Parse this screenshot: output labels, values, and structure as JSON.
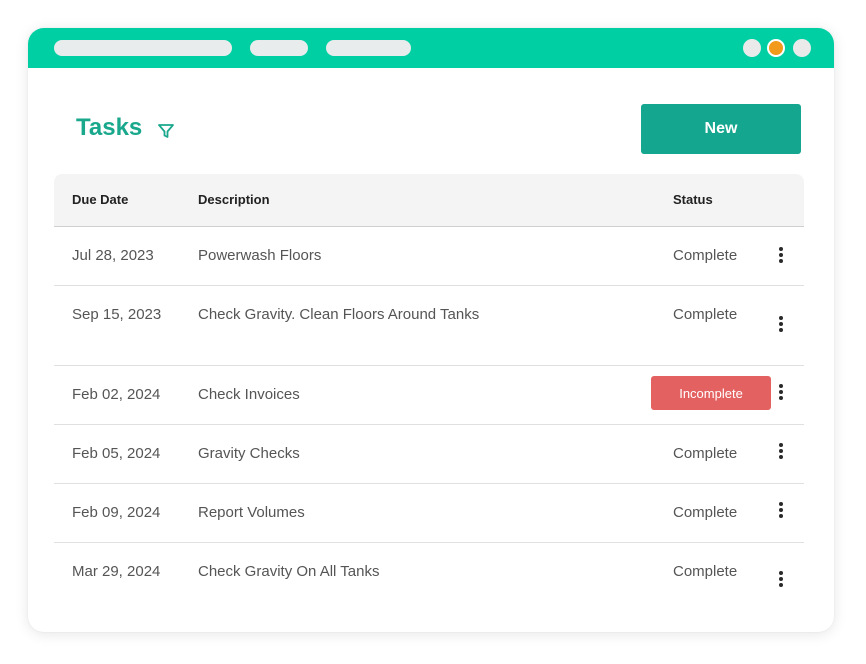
{
  "header": {
    "title": "Tasks",
    "new_label": "New"
  },
  "table": {
    "columns": {
      "due_date": "Due Date",
      "description": "Description",
      "status": "Status"
    },
    "rows": [
      {
        "date": "Jul 28, 2023",
        "description": "Powerwash Floors",
        "status": "Complete"
      },
      {
        "date": "Sep 15, 2023",
        "description": "Check Gravity. Clean Floors Around Tanks",
        "status": "Complete"
      },
      {
        "date": "Feb 02, 2024",
        "description": "Check Invoices",
        "status": "Incomplete"
      },
      {
        "date": "Feb 05, 2024",
        "description": "Gravity Checks",
        "status": "Complete"
      },
      {
        "date": "Feb 09, 2024",
        "description": "Report Volumes",
        "status": "Complete"
      },
      {
        "date": "Mar 29, 2024",
        "description": "Check Gravity On All Tanks",
        "status": "Complete"
      }
    ]
  },
  "colors": {
    "accent": "#00cfa4",
    "title_text": "#19a88c",
    "button": "#14a68e",
    "incomplete_badge": "#e46161",
    "window_dot": "#f29a1c"
  },
  "icons": {
    "filter": "filter-icon",
    "row_menu": "more-vertical-icon"
  }
}
